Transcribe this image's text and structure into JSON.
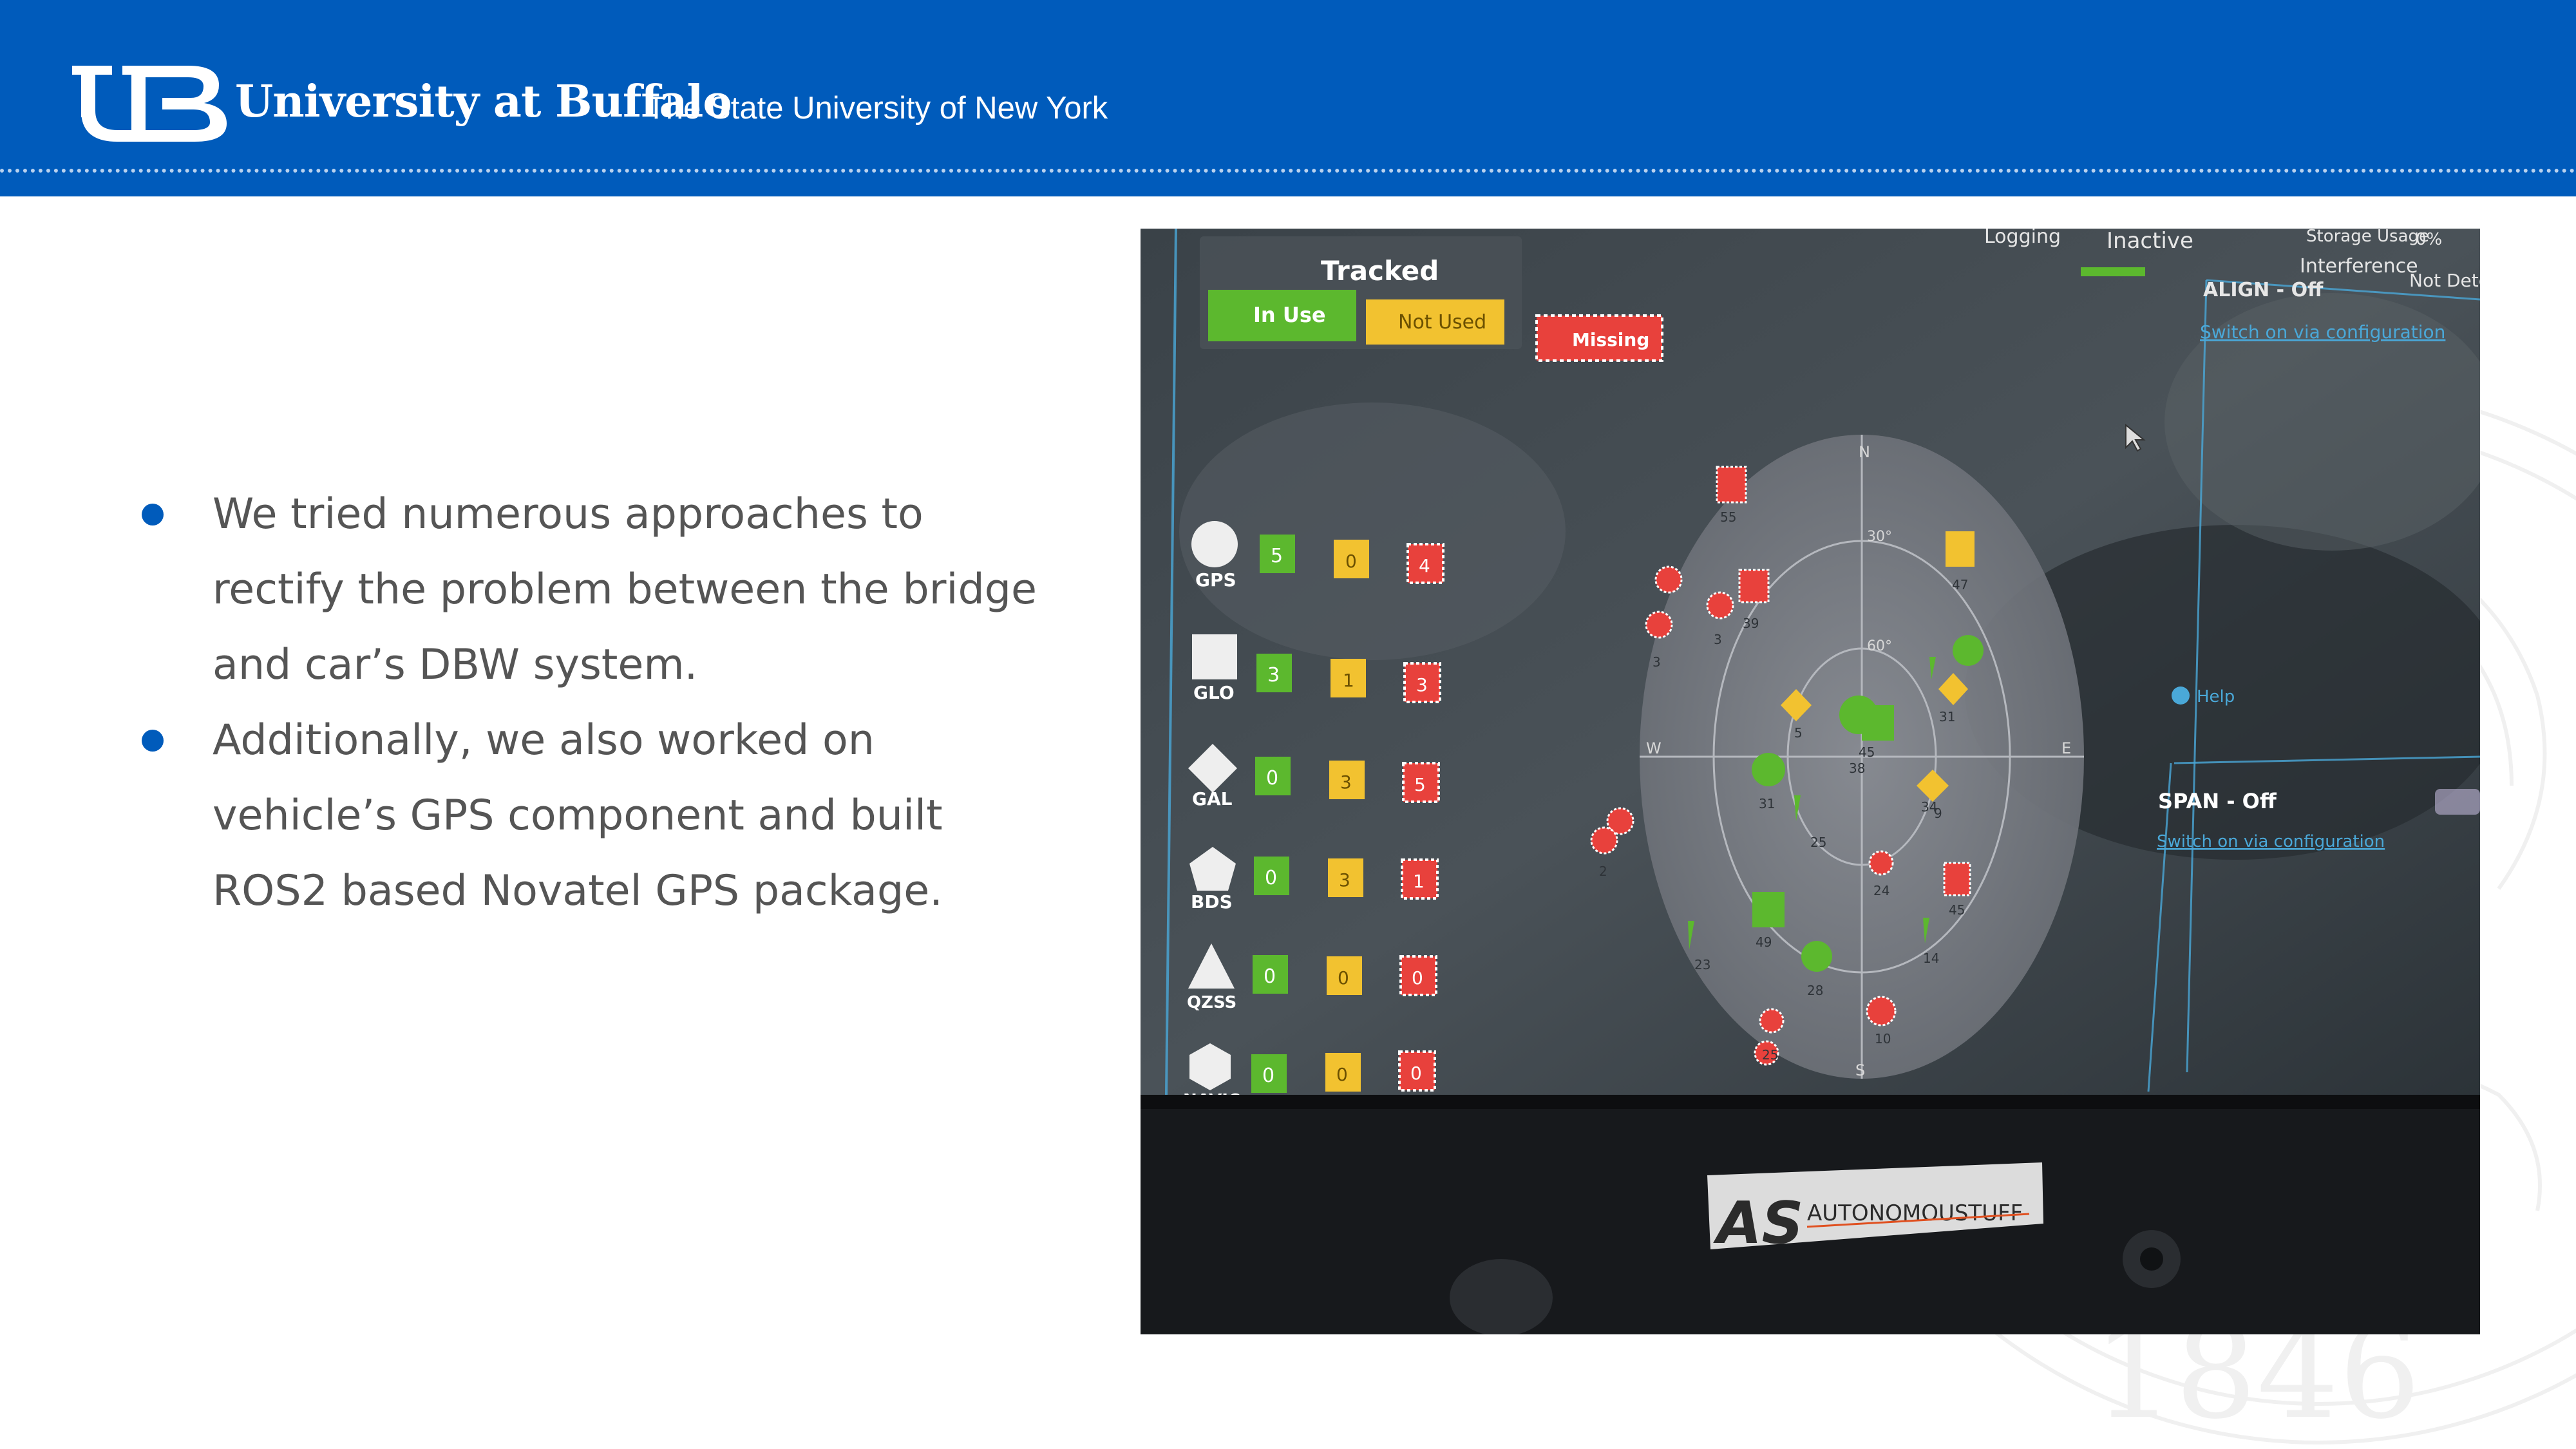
{
  "header": {
    "university": "University at Buffalo",
    "subtitle": "The State University of New York",
    "logo_icon": "ub-monogram-icon",
    "background_color": "#005bbb"
  },
  "bullets": [
    {
      "text": "We tried numerous approaches to rectify the problem between the bridge and car’s DBW system."
    },
    {
      "text": "Additionally, we also worked on vehicle’s GPS component and built ROS2 based Novatel GPS package."
    }
  ],
  "watermark": {
    "year": "1846"
  },
  "photo": {
    "top_bar": {
      "logging": "Logging",
      "status": "Inactive",
      "storage": "Storage Usage",
      "storage_value": "0%",
      "interference": "Interference",
      "interference_value": "Not Detec",
      "align": "ALIGN - Off"
    },
    "legend": {
      "title": "Tracked",
      "in_use": "In Use",
      "not_used": "Not Used",
      "missing": "Missing"
    },
    "constellations": [
      {
        "name": "GPS",
        "in_use": "5",
        "not_used": "0",
        "missing": "4"
      },
      {
        "name": "GLO",
        "in_use": "3",
        "not_used": "1",
        "missing": "3"
      },
      {
        "name": "GAL",
        "in_use": "0",
        "not_used": "3",
        "missing": "5"
      },
      {
        "name": "BDS",
        "in_use": "0",
        "not_used": "3",
        "missing": "1"
      },
      {
        "name": "QZSS",
        "in_use": "0",
        "not_used": "0",
        "missing": "0"
      },
      {
        "name": "NAVIC",
        "in_use": "0",
        "not_used": "0",
        "missing": "0"
      }
    ],
    "skyplot": {
      "north": "N",
      "south": "S",
      "east": "E",
      "west": "W",
      "elev_30": "30°",
      "elev_60": "60°",
      "sat_labels": [
        "55",
        "39",
        "3",
        "3",
        "47",
        "5",
        "45",
        "38",
        "31",
        "31",
        "34",
        "9",
        "25",
        "2",
        "24",
        "45",
        "49",
        "23",
        "28",
        "14",
        "10",
        "25"
      ]
    },
    "align_link": "Switch on via configuration",
    "help": "Help",
    "span": "SPAN - Off",
    "span_link": "Switch on via configuration",
    "brand": "AUTONOMOUSTUFF",
    "brand_mark": "AS",
    "colors": {
      "in_use": "#5cb82e",
      "not_used": "#f2c230",
      "missing": "#e8413c",
      "accent": "#4aa8d8"
    }
  }
}
